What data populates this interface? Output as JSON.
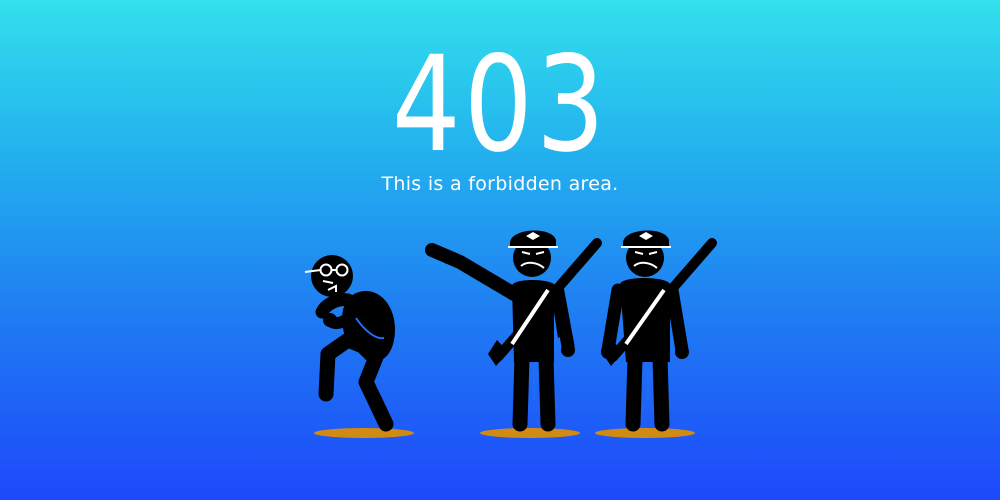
{
  "error": {
    "code": "403",
    "message": "This is a forbidden area."
  },
  "illustration": {
    "figures": [
      "sneaking-person-with-glasses",
      "guard-pointing",
      "guard-standing"
    ],
    "colors": {
      "figure": "#000000",
      "ground_shadow": "#d18a12",
      "accent": "#ffffff",
      "gradient_top": "#33e0ec",
      "gradient_bottom": "#1d48fb"
    }
  }
}
